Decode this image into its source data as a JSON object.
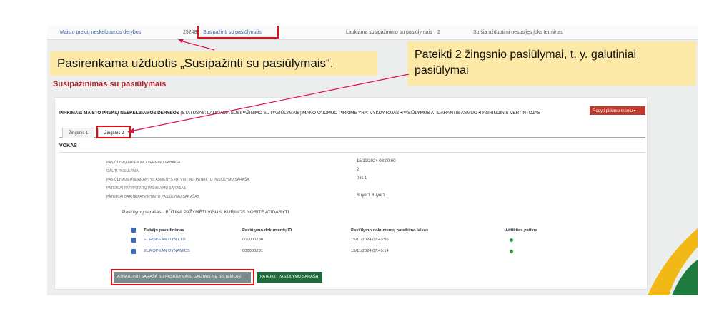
{
  "top_row": {
    "procurement_name": "Maisto prekių neskelbiamos derybos",
    "number": "25248",
    "task_link": "Susipažinti su pasiūlymais",
    "status": "Laukiama susipažinimo su pasiūlymais",
    "count": "2",
    "deadline_note": "Su šia užduotimi nesusijęs joks terminas"
  },
  "callouts": {
    "task_selected": "Pasirenkama užduotis „Susipažinti su pasiūlymais“.",
    "step2_offers": "Pateikti 2 žingsnio pasiūlymai, t. y. galutiniai pasiūlymai"
  },
  "page_title": "Susipažinimas su pasiūlymais",
  "purchase": {
    "label": "PIRKIMAS:",
    "name": "MAISTO PREKIŲ NESKELBIAMOS DERYBOS",
    "status": "(STATUSAS: LAUKIAMA SUSIPAŽINIMO SU PASIŪLYMAIS) MANO VAIDMUO PIRKIME YRA: VYKDYTOJAS •PASIŪLYMUS ATIDARANTIS ASMUO •PAGRINDINIS VERTINTOJAS",
    "menu_button": "Rodyti pirkimo meniu ▾"
  },
  "tabs": [
    {
      "label": "Žingsnis 1"
    },
    {
      "label": "Žingsnis 2"
    }
  ],
  "section": "VOKAS",
  "info": [
    {
      "label": "Pasiūlymų pateikimo termino pabaiga",
      "value": "15/11/2024 08:00:00"
    },
    {
      "label": "Gauti pasiūlymai",
      "value": "2"
    },
    {
      "label": "Pasiūlymus atidarantys asmenys patvirtino pateiktų pasiūlymų sąrašą",
      "value": "0 iš 1"
    },
    {
      "label": "Pateikiai patvirtintų pasiūlymų sąrašas",
      "value": ""
    },
    {
      "label": "Pateikiai dar nepatvirtintų pasiūlymų sąrašas",
      "value": "Buyer1 Buyer1"
    }
  ],
  "offers_list": {
    "title": "Pasiūlymų sąrašas · BŪTINA PAŽYMĖTI VISUS, KURIUOS NORITE ATIDARYTI",
    "columns": [
      "Tiekėjo pavadinimas",
      "Pasiūlymo dokumentų ID",
      "Pasiūlymo dokumentų pateikimo laikas",
      "Atitikties patikra"
    ],
    "rows": [
      {
        "supplier": "EUROPEAN DYN LTD",
        "doc_id": "000000290",
        "time": "15/11/2024 07:43:56"
      },
      {
        "supplier": "EUROPEAN DYNAMICS",
        "doc_id": "000000291",
        "time": "15/11/2024 07:45:14"
      }
    ]
  },
  "buttons": {
    "refresh": "ATNAUJINTI SĄRAŠĄ SU PASIŪLYMAIS, GAUTAIS NE SISTEMOJE",
    "submit": "PATEIKTI PASIŪLYMŲ SĄRAŠĄ"
  },
  "colors": {
    "accent_red": "#b0252b",
    "callout_bg": "#fde9a7",
    "green_button": "#1f6b3a",
    "link_blue": "#3a66a8"
  }
}
